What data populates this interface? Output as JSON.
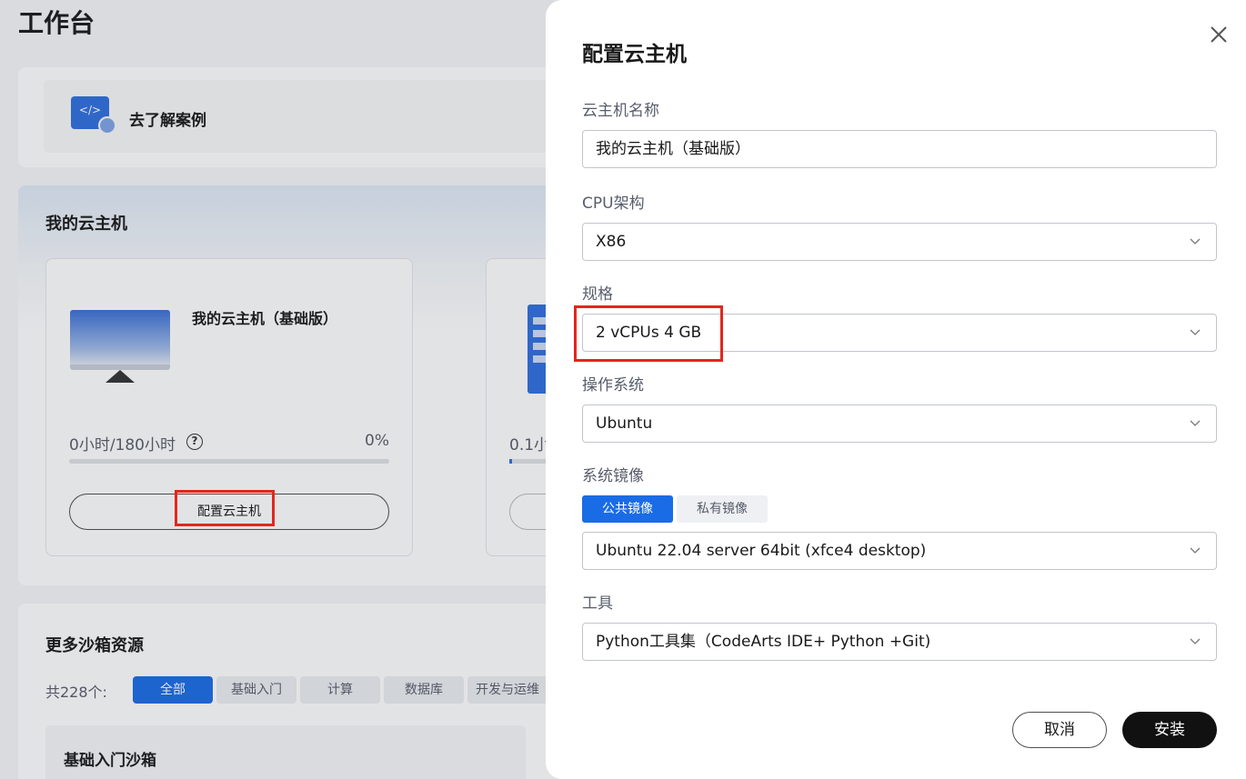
{
  "workbench": {
    "title": "工作台",
    "case_link": "去了解案例",
    "case_icon_glyph": "</>",
    "my_vm_title": "我的云主机",
    "vm_card": {
      "name": "我的云主机（基础版）",
      "usage": "0小时/180小时",
      "help_glyph": "?",
      "percent": "0%",
      "progress_fraction": 0.0,
      "configure_button": "配置云主机"
    },
    "vm_card2": {
      "usage": "0.1小"
    },
    "more_title": "更多沙箱资源",
    "total_label": "共228个:",
    "filters": [
      "全部",
      "基础入门",
      "计算",
      "数据库",
      "开发与运维"
    ],
    "active_filter": "全部",
    "basic_card_title": "基础入门沙箱"
  },
  "drawer": {
    "title": "配置云主机",
    "close_icon": "close-icon",
    "fields": {
      "name_label": "云主机名称",
      "name_value": "我的云主机（基础版）",
      "cpu_label": "CPU架构",
      "cpu_value": "X86",
      "spec_label": "规格",
      "spec_value": "2 vCPUs 4 GB",
      "os_label": "操作系统",
      "os_value": "Ubuntu",
      "image_label": "系统镜像",
      "image_tab_public": "公共镜像",
      "image_tab_private": "私有镜像",
      "image_value": "Ubuntu 22.04 server 64bit (xfce4 desktop)",
      "tools_label": "工具",
      "tools_value": "Python工具集（CodeArts IDE+ Python +Git)"
    },
    "cancel_button": "取消",
    "install_button": "安装"
  },
  "colors": {
    "accent": "#1a6ce6",
    "highlight_box": "#e3261e",
    "install_button": "#111111"
  }
}
